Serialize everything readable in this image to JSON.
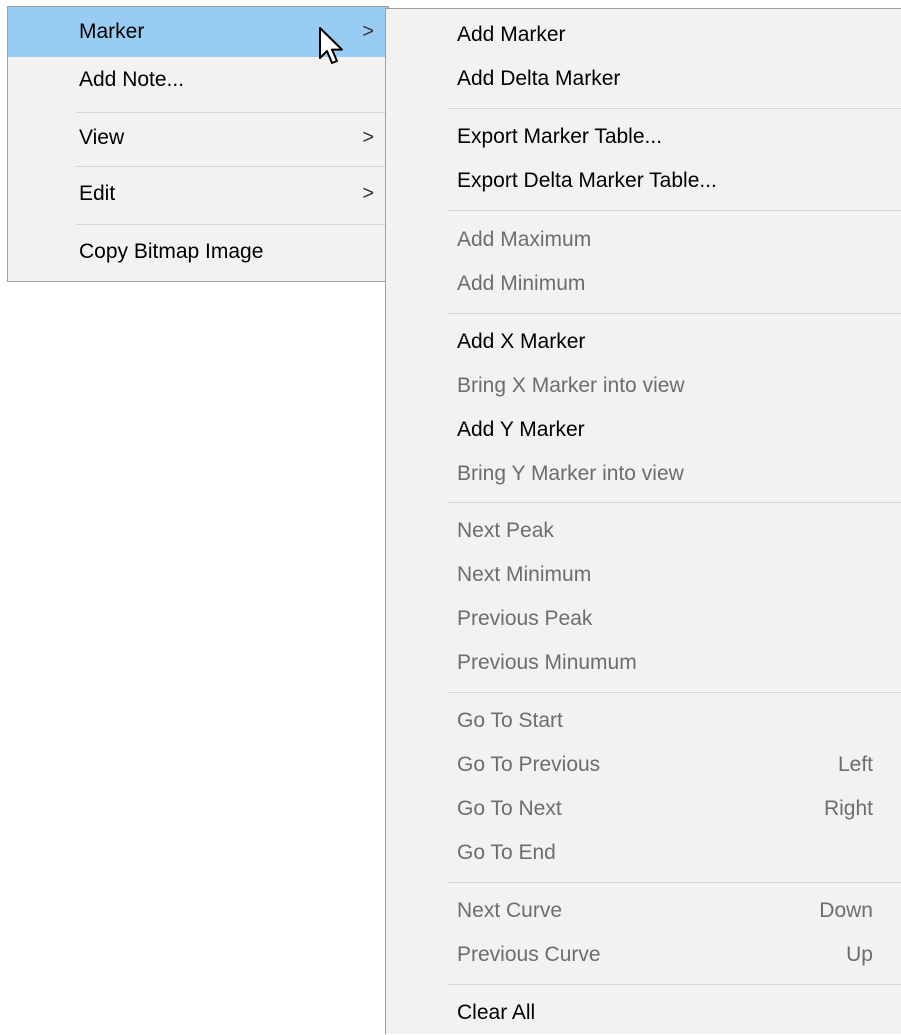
{
  "main_menu": {
    "items": [
      {
        "label": "Marker",
        "arrow": ">"
      },
      {
        "label": "Add Note..."
      },
      {
        "label": "View",
        "arrow": ">"
      },
      {
        "label": "Edit",
        "arrow": ">"
      },
      {
        "label": "Copy Bitmap Image"
      }
    ]
  },
  "submenu": {
    "items": [
      {
        "label": "Add Marker",
        "enabled": true
      },
      {
        "label": "Add Delta Marker",
        "enabled": true
      },
      {
        "label": "Export Marker Table...",
        "enabled": true
      },
      {
        "label": "Export Delta Marker Table...",
        "enabled": true
      },
      {
        "label": "Add Maximum",
        "enabled": false
      },
      {
        "label": "Add Minimum",
        "enabled": false
      },
      {
        "label": "Add X Marker",
        "enabled": true
      },
      {
        "label": "Bring X Marker into view",
        "enabled": false
      },
      {
        "label": "Add Y Marker",
        "enabled": true
      },
      {
        "label": "Bring Y Marker into view",
        "enabled": false
      },
      {
        "label": "Next Peak",
        "enabled": false
      },
      {
        "label": "Next Minimum",
        "enabled": false
      },
      {
        "label": "Previous Peak",
        "enabled": false
      },
      {
        "label": "Previous Minumum",
        "enabled": false
      },
      {
        "label": "Go To Start",
        "enabled": false
      },
      {
        "label": "Go To Previous",
        "shortcut": "Left",
        "enabled": false
      },
      {
        "label": "Go To Next",
        "shortcut": "Right",
        "enabled": false
      },
      {
        "label": "Go To End",
        "enabled": false
      },
      {
        "label": "Next Curve",
        "shortcut": "Down",
        "enabled": false
      },
      {
        "label": "Previous Curve",
        "shortcut": "Up",
        "enabled": false
      },
      {
        "label": "Clear All",
        "enabled": true
      }
    ]
  },
  "colors": {
    "highlight": "#99ccf3",
    "disabled_text": "#6d6d6d"
  },
  "cursor_icon": "arrow-cursor-icon"
}
